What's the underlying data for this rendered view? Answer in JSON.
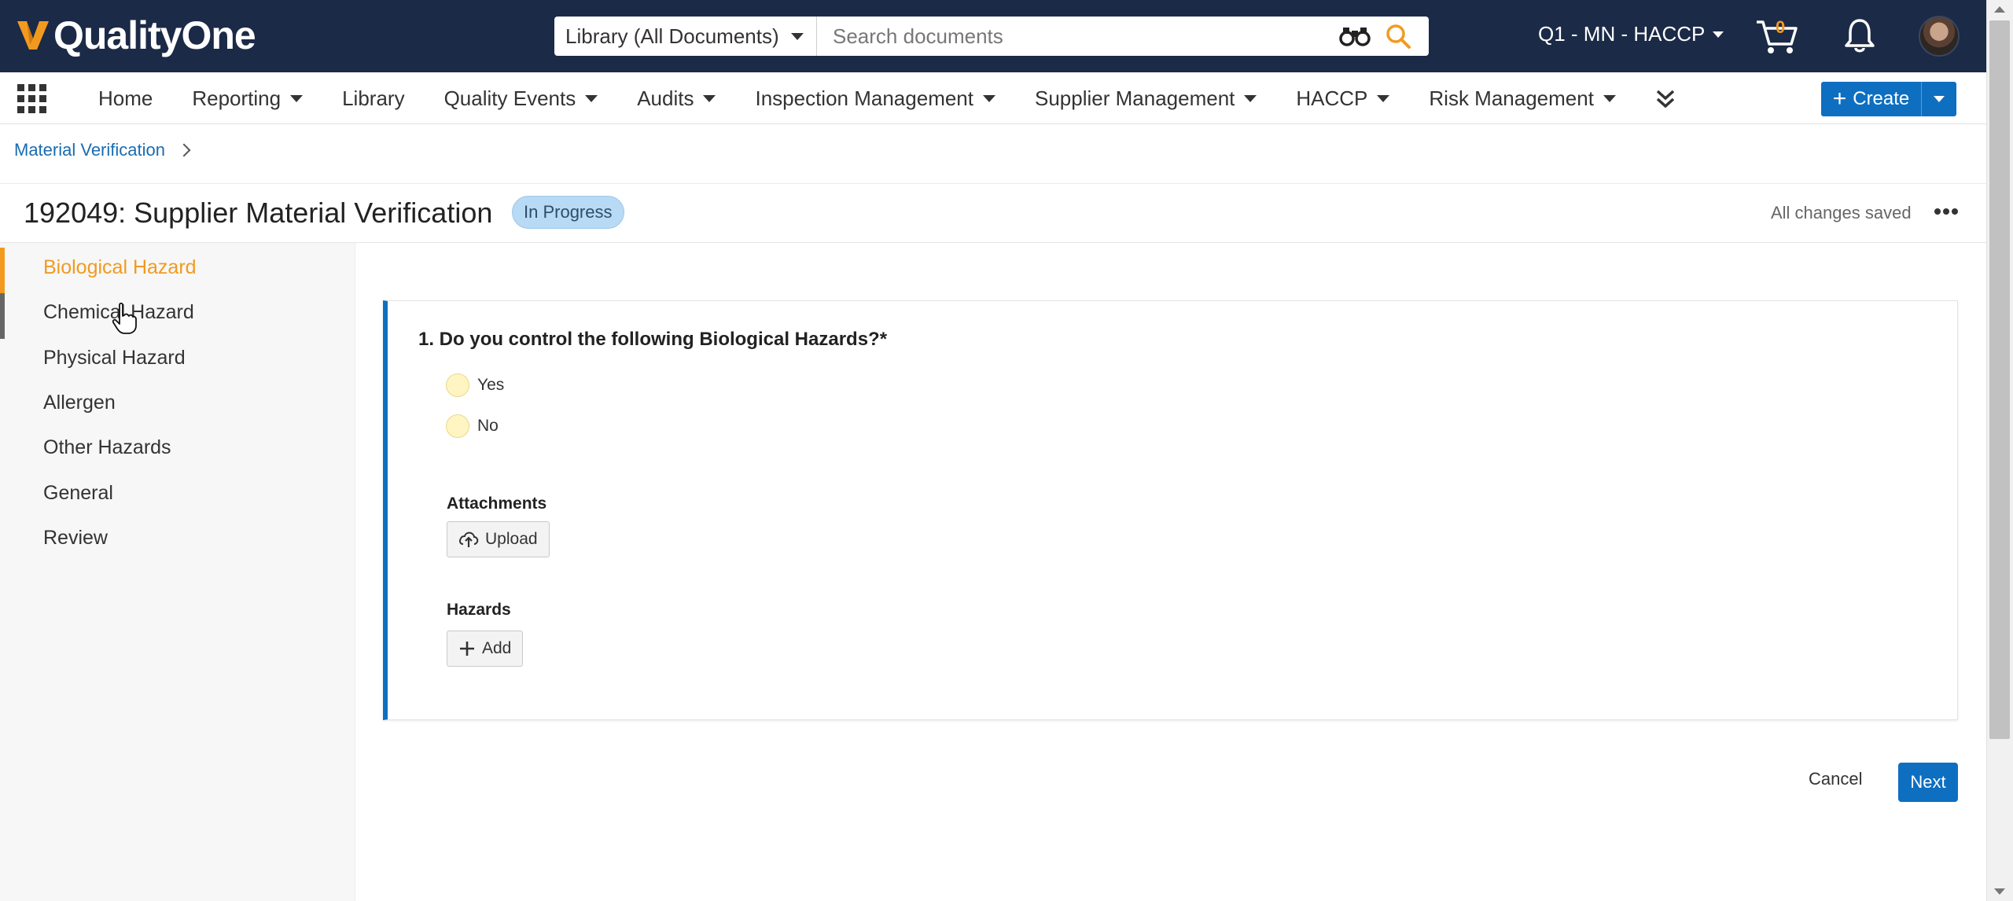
{
  "app": {
    "logo_text": "QualityOne",
    "vault": "Q1 - MN - HACCP",
    "cart_count": "0"
  },
  "search": {
    "scope": "Library (All Documents)",
    "placeholder": "Search documents"
  },
  "nav": {
    "items": [
      {
        "label": "Home",
        "dropdown": false
      },
      {
        "label": "Reporting",
        "dropdown": true
      },
      {
        "label": "Library",
        "dropdown": false
      },
      {
        "label": "Quality Events",
        "dropdown": true
      },
      {
        "label": "Audits",
        "dropdown": true
      },
      {
        "label": "Inspection Management",
        "dropdown": true
      },
      {
        "label": "Supplier Management",
        "dropdown": true
      },
      {
        "label": "HACCP",
        "dropdown": true
      },
      {
        "label": "Risk Management",
        "dropdown": true
      }
    ],
    "create_label": "Create"
  },
  "breadcrumb": {
    "item": "Material Verification"
  },
  "page": {
    "title": "192049: Supplier Material Verification",
    "status": "In Progress",
    "saved_text": "All changes saved"
  },
  "sidebar": {
    "items": [
      {
        "label": "Biological Hazard"
      },
      {
        "label": "Chemical Hazard"
      },
      {
        "label": "Physical Hazard"
      },
      {
        "label": "Allergen"
      },
      {
        "label": "Other Hazards"
      },
      {
        "label": "General"
      },
      {
        "label": "Review"
      }
    ]
  },
  "form": {
    "question": "1. Do you control the following Biological Hazards?*",
    "options": [
      "Yes",
      "No"
    ],
    "attachments_label": "Attachments",
    "upload_label": "Upload",
    "hazards_label": "Hazards",
    "add_label": "Add"
  },
  "actions": {
    "cancel": "Cancel",
    "next": "Next"
  },
  "colors": {
    "topbar": "#1b2a47",
    "accent_blue": "#0e6fc1",
    "active_orange": "#f29a1f",
    "status_badge": "#b8daf5"
  }
}
